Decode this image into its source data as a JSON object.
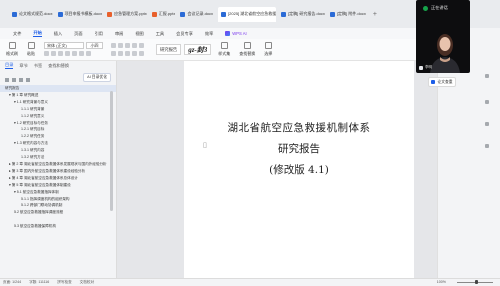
{
  "tabs": [
    {
      "label": "论文格式规范.docx",
      "color": "#2b6bd6"
    },
    {
      "label": "项目申报书模板.docx",
      "color": "#2b6bd6"
    },
    {
      "label": "应急管理方案.pptx",
      "color": "#e8602c"
    },
    {
      "label": "汇报.pptx",
      "color": "#e8602c"
    },
    {
      "label": "会议记录.docx",
      "color": "#2b6bd6"
    },
    {
      "label": "[2025] 湖北省航空应急救援...",
      "color": "#2b6bd6"
    },
    {
      "label": "[定稿] 研究报告.docx",
      "color": "#2b6bd6"
    },
    {
      "label": "[定稿] 附件.docx",
      "color": "#2b6bd6"
    }
  ],
  "ribbon": {
    "menus": [
      "文件",
      "开始",
      "插入",
      "页面",
      "引用",
      "审阅",
      "视图",
      "工具",
      "会员专享",
      "效率"
    ],
    "active_index": 1,
    "wps_ai": "WPS AI"
  },
  "toolbar": {
    "format_painter": "格式刷",
    "paste": "粘贴",
    "font": "宋体 (正文)",
    "size": "小四",
    "style_normal": "研究报告",
    "style_heading": "gz-封3",
    "style_set": "样式集",
    "find_replace": "查找替换",
    "select": "选择"
  },
  "sidebar": {
    "tabs": [
      "目录",
      "章节",
      "书签",
      "查找和替换"
    ],
    "active_tab": 0,
    "ai_button": "AI 目录优化",
    "toc": [
      {
        "text": "研究报告",
        "indent": 0,
        "selected": true
      },
      {
        "text": "▾ 第 1 章  研究概述",
        "indent": 1
      },
      {
        "text": "▾ 1.1  研究背景与意义",
        "indent": 2
      },
      {
        "text": "1.1.1  研究背景",
        "indent": 3
      },
      {
        "text": "1.1.2  研究意义",
        "indent": 3
      },
      {
        "text": "▾ 1.2  研究目标与任务",
        "indent": 2
      },
      {
        "text": "1.2.1  研究目标",
        "indent": 3
      },
      {
        "text": "1.2.2  研究任务",
        "indent": 3
      },
      {
        "text": "▾ 1.3  研究内容与方法",
        "indent": 2
      },
      {
        "text": "1.3.1  研究内容",
        "indent": 3
      },
      {
        "text": "1.3.2  研究方法",
        "indent": 3
      },
      {
        "text": "▸ 第 2 章  湖北省航空应急救援体系发展现状与国内外经验分析",
        "indent": 1
      },
      {
        "text": "▸ 第 3 章  国内外航空应急救援体系建设经验分析",
        "indent": 1
      },
      {
        "text": "▸ 第 4 章  湖北省航空应急救援体系总体设计",
        "indent": 1
      },
      {
        "text": "▾ 第 5 章  湖北省航空应急救援体制建设",
        "indent": 1
      },
      {
        "text": "▾ 5.1  航空应急救援指挥体制",
        "indent": 2
      },
      {
        "text": "5.1.1  指挥调度机构的组织架构",
        "indent": 3
      },
      {
        "text": "5.1.2  跨部门联动协调机制",
        "indent": 3
      },
      {
        "text": "5.2  航空应急救援指挥调度流程",
        "indent": 2
      },
      {
        "text": "",
        "indent": 0
      },
      {
        "text": "5.3  航空应急救援保障机构",
        "indent": 2
      }
    ]
  },
  "document": {
    "title": "湖北省航空应急救援机制体系",
    "subtitle": "研究报告",
    "version": "(修改版 4.1)"
  },
  "video": {
    "status": "正在讲话",
    "name": "李明"
  },
  "right_panel": {
    "doc_button": "论文查重"
  },
  "status_bar": {
    "page": "页面: 1/244",
    "words": "字数: 111116",
    "spell": "拼写检查",
    "proofread": "文档校对",
    "zoom": "100%"
  }
}
